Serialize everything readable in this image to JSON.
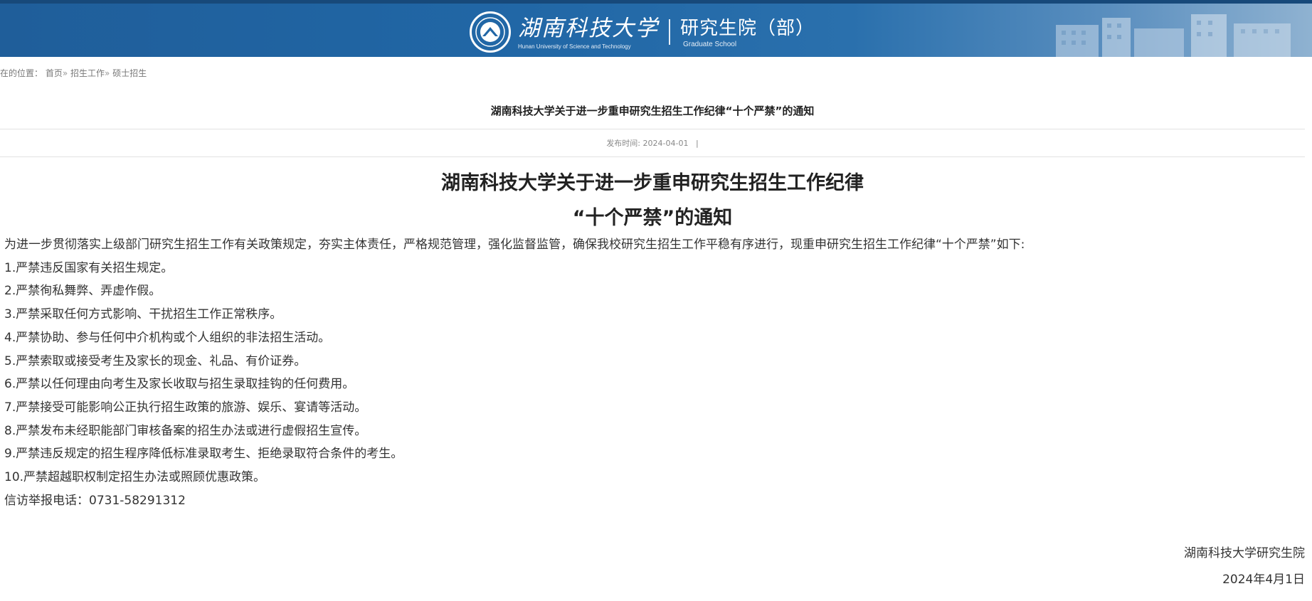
{
  "header": {
    "school_name": "湖南科技大学",
    "school_name_en": "Hunan University of Science and Technology",
    "department": "研究生院（部）",
    "department_en": "Graduate School",
    "logo_icon": "university-seal-icon",
    "brand_color": "#2167a6"
  },
  "breadcrumb": {
    "prefix": "在的位置：",
    "items": [
      "首页",
      "招生工作",
      "硕士招生"
    ],
    "separator": "»"
  },
  "article": {
    "title": "湖南科技大学关于进一步重申研究生招生工作纪律“十个严禁”的通知",
    "publish_label": "发布时间:",
    "publish_date": "2024-04-01",
    "meta_separator": "|"
  },
  "document": {
    "title_line1": "湖南科技大学关于进一步重申研究生招生工作纪律",
    "title_line2": "“十个严禁”的通知",
    "intro": "为进一步贯彻落实上级部门研究生招生工作有关政策规定，夯实主体责任，严格规范管理，强化监督监管，确保我校研究生招生工作平稳有序进行，现重申研究生招生工作纪律“十个严禁”如下:",
    "rules": [
      "1.严禁违反国家有关招生规定。",
      "2.严禁徇私舞弊、弄虚作假。",
      "3.严禁采取任何方式影响、干扰招生工作正常秩序。",
      "4.严禁协助、参与任何中介机构或个人组织的非法招生活动。",
      "5.严禁索取或接受考生及家长的现金、礼品、有价证券。",
      "6.严禁以任何理由向考生及家长收取与招生录取挂钩的任何费用。",
      "7.严禁接受可能影响公正执行招生政策的旅游、娱乐、宴请等活动。",
      "8.严禁发布未经职能部门审核备案的招生办法或进行虚假招生宣传。",
      "9.严禁违反规定的招生程序降低标准录取考生、拒绝录取符合条件的考生。",
      "10.严禁超越职权制定招生办法或照顾优惠政策。"
    ],
    "hotline": "信访举报电话：0731-58291312",
    "signature_org": "湖南科技大学研究生院",
    "signature_date": "2024年4月1日"
  }
}
